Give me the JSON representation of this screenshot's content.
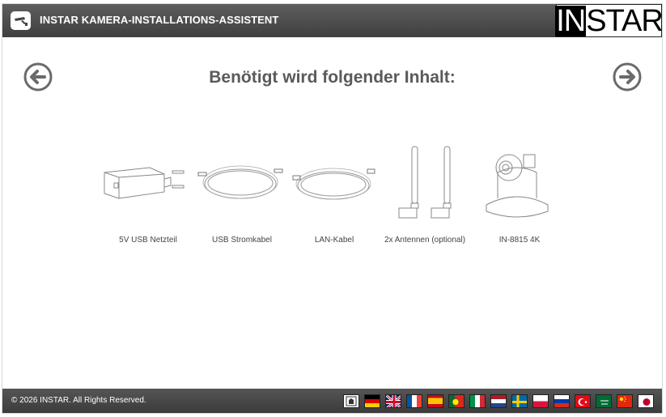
{
  "header": {
    "title": "INSTAR KAMERA-INSTALLATIONS-ASSISTENT",
    "brand_part1": "IN",
    "brand_part2": "STAR",
    "logo_icon": "camera-logo-icon"
  },
  "nav": {
    "prev_icon": "arrow-left-circle-icon",
    "next_icon": "arrow-right-circle-icon"
  },
  "main": {
    "title": "Benötigt wird folgender Inhalt:",
    "items": [
      {
        "label": "5V USB Netzteil",
        "icon": "power-adapter-icon"
      },
      {
        "label": "USB Stromkabel",
        "icon": "usb-cable-icon"
      },
      {
        "label": "LAN-Kabel",
        "icon": "lan-cable-icon"
      },
      {
        "label": "2x Antennen (optional)",
        "icon": "antenna-icon"
      },
      {
        "label": "IN-8815 4K",
        "icon": "camera-icon"
      }
    ]
  },
  "footer": {
    "copyright": "© 2026 INSTAR. All Rights Reserved.",
    "languages": [
      "de",
      "en",
      "fr",
      "es",
      "pt",
      "it",
      "nl",
      "se",
      "pl",
      "ru",
      "tr",
      "ar",
      "cn",
      "jp"
    ]
  },
  "colors": {
    "header_bg": "#4a4a4a",
    "title_text": "#5a5a5a",
    "icon_stroke": "#888888"
  }
}
